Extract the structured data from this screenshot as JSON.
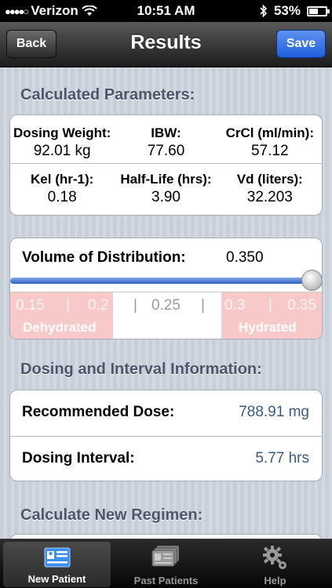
{
  "status": {
    "carrier": "Verizon",
    "time": "10:51 AM",
    "battery": "53%"
  },
  "nav": {
    "title": "Results",
    "back_label": "Back",
    "save_label": "Save"
  },
  "calculated": {
    "header": "Calculated Parameters:",
    "params": [
      {
        "label": "Dosing Weight:",
        "value": "92.01 kg"
      },
      {
        "label": "IBW:",
        "value": "77.60"
      },
      {
        "label": "CrCl (ml/min):",
        "value": "57.12"
      },
      {
        "label": "Kel (hr-1):",
        "value": "0.18"
      },
      {
        "label": "Half-Life (hrs):",
        "value": "3.90"
      },
      {
        "label": "Vd (liters):",
        "value": "32.203"
      }
    ]
  },
  "vd": {
    "label": "Volume of Distribution:",
    "value": "0.350",
    "slider_fraction": 1.0,
    "ticks": [
      "0.15",
      "0.2",
      "0.25",
      "0.3",
      "0.35"
    ],
    "separator": "|",
    "zone_left": "Dehydrated",
    "zone_right": "Hydrated"
  },
  "dosing": {
    "header": "Dosing and Interval Information:",
    "rows": [
      {
        "label": "Recommended Dose:",
        "value": "788.91 mg"
      },
      {
        "label": "Dosing Interval:",
        "value": "5.77 hrs"
      }
    ]
  },
  "regimen": {
    "header": "Calculate New Regimen:"
  },
  "tabs": [
    {
      "label": "New Patient",
      "icon": "id-card-icon",
      "active": true
    },
    {
      "label": "Past Patients",
      "icon": "patient-records-icon",
      "active": false
    },
    {
      "label": "Help",
      "icon": "gear-icon",
      "active": false
    }
  ],
  "colors": {
    "nav_save": "#1f5fdc",
    "zone": "#f8c9c9",
    "dose_value": "#3a5a86"
  }
}
